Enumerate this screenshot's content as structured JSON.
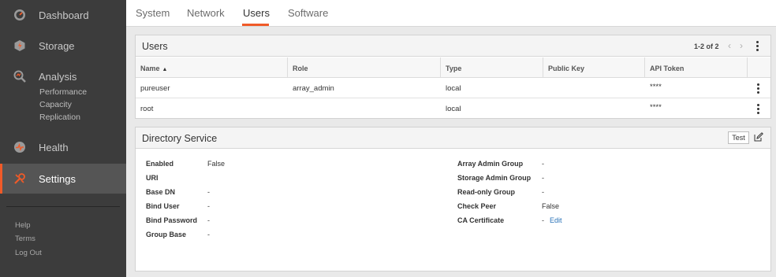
{
  "sidebar": {
    "items": [
      {
        "label": "Dashboard",
        "icon": "dashboard-icon"
      },
      {
        "label": "Storage",
        "icon": "storage-icon"
      },
      {
        "label": "Analysis",
        "icon": "analysis-icon"
      },
      {
        "label": "Health",
        "icon": "health-icon"
      },
      {
        "label": "Settings",
        "icon": "settings-icon"
      }
    ],
    "analysis_sub": [
      "Performance",
      "Capacity",
      "Replication"
    ],
    "footer": [
      "Help",
      "Terms",
      "Log Out"
    ]
  },
  "tabs": [
    "System",
    "Network",
    "Users",
    "Software"
  ],
  "active_tab": "Users",
  "accent_color": "#f05a28",
  "users_panel": {
    "title": "Users",
    "pager": "1-2 of 2",
    "columns": [
      "Name",
      "Role",
      "Type",
      "Public Key",
      "API Token"
    ],
    "rows": [
      {
        "name": "pureuser",
        "role": "array_admin",
        "type": "local",
        "public_key": "",
        "api_token": "****"
      },
      {
        "name": "root",
        "role": "",
        "type": "local",
        "public_key": "",
        "api_token": "****"
      }
    ]
  },
  "directory_panel": {
    "title": "Directory Service",
    "test_label": "Test",
    "left": [
      {
        "label": "Enabled",
        "value": "False"
      },
      {
        "label": "URI",
        "value": ""
      },
      {
        "label": "Base DN",
        "value": "-"
      },
      {
        "label": "Bind User",
        "value": "-"
      },
      {
        "label": "Bind Password",
        "value": "-"
      },
      {
        "label": "Group Base",
        "value": "-"
      }
    ],
    "right": [
      {
        "label": "Array Admin Group",
        "value": "-"
      },
      {
        "label": "Storage Admin Group",
        "value": "-"
      },
      {
        "label": "Read-only Group",
        "value": "-"
      },
      {
        "label": "Check Peer",
        "value": "False"
      },
      {
        "label": "CA Certificate",
        "value": "-",
        "link": "Edit"
      }
    ]
  }
}
